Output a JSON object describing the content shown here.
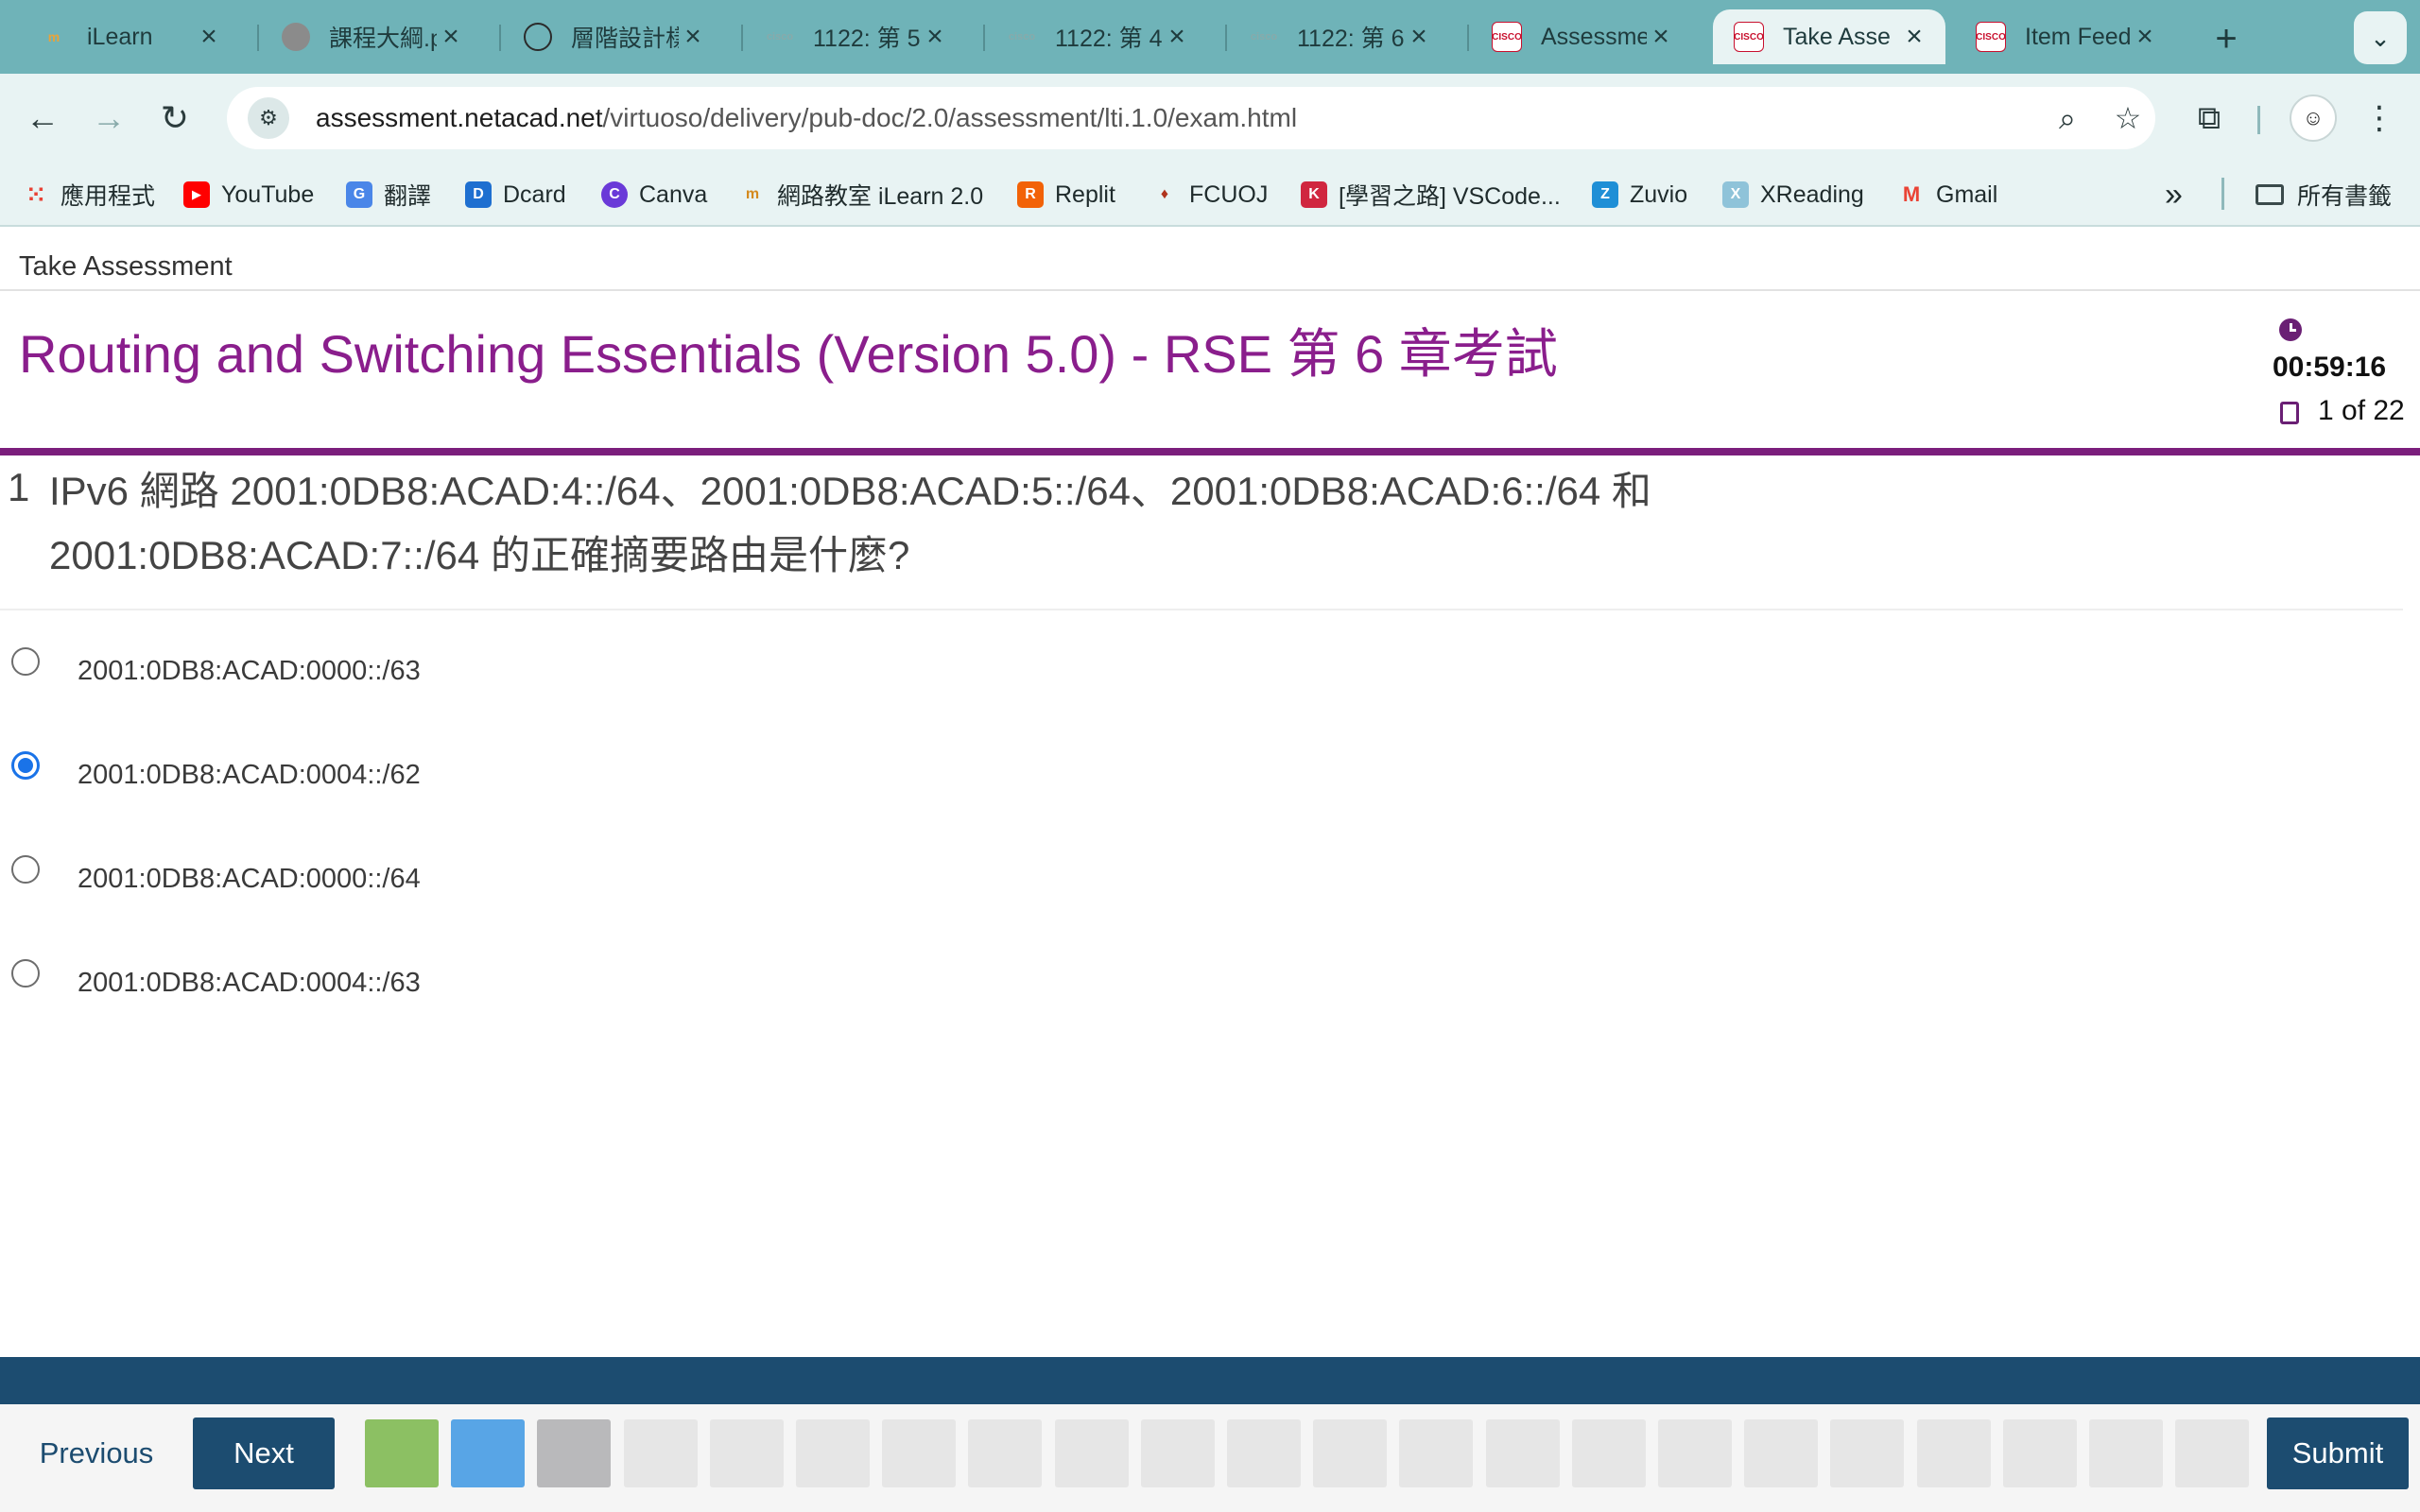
{
  "browser": {
    "tabs": [
      {
        "label": "iLearn",
        "favicon": "ilearn-icon",
        "color": "#e8a33a"
      },
      {
        "label": "課程大綱.p",
        "favicon": "seal-icon",
        "color": "#7a7a7a"
      },
      {
        "label": "層階設計樣",
        "favicon": "chatgpt-icon",
        "color": "#2b2b2b"
      },
      {
        "label": "1122: 第 5",
        "favicon": "cisco-icon",
        "color": "#9ab"
      },
      {
        "label": "1122: 第 4",
        "favicon": "cisco-icon",
        "color": "#9ab"
      },
      {
        "label": "1122: 第 6",
        "favicon": "cisco-icon",
        "color": "#9ab"
      },
      {
        "label": "Assessme",
        "favicon": "cisco-icon",
        "color": "#c8102e"
      },
      {
        "label": "Take Asse",
        "favicon": "cisco-icon",
        "color": "#c8102e",
        "active": true
      },
      {
        "label": "Item Feed",
        "favicon": "cisco-icon",
        "color": "#c8102e"
      }
    ],
    "url_host": "assessment.netacad.net",
    "url_path": "/virtuoso/delivery/pub-doc/2.0/assessment/lti.1.0/exam.html",
    "bookmarks": [
      {
        "label": "應用程式",
        "icon": "apps-grid-icon"
      },
      {
        "label": "YouTube",
        "icon": "youtube-icon"
      },
      {
        "label": "翻譯",
        "icon": "translate-icon"
      },
      {
        "label": "Dcard",
        "icon": "dcard-icon"
      },
      {
        "label": "Canva",
        "icon": "canva-icon"
      },
      {
        "label": "網路教室 iLearn 2.0",
        "icon": "ilearn-icon"
      },
      {
        "label": "Replit",
        "icon": "replit-icon"
      },
      {
        "label": "FCUOJ",
        "icon": "fcuoj-icon"
      },
      {
        "label": "[學習之路] VSCode...",
        "icon": "vscode-bookmark-icon"
      },
      {
        "label": "Zuvio",
        "icon": "zuvio-icon"
      },
      {
        "label": "XReading",
        "icon": "xreading-icon"
      },
      {
        "label": "Gmail",
        "icon": "gmail-icon"
      }
    ],
    "all_bookmarks": "所有書籤"
  },
  "page": {
    "breadcrumb": "Take Assessment",
    "title": "Routing and Switching Essentials (Version 5.0) - RSE 第 6 章考試",
    "timer": "00:59:16",
    "counter": "1 of 22",
    "accent": "#7b1e7c"
  },
  "question": {
    "number": "1",
    "text": "IPv6 網路 2001:0DB8:ACAD:4::/64、2001:0DB8:ACAD:5::/64、2001:0DB8:ACAD:6::/64 和 2001:0DB8:ACAD:7::/64 的正確摘要路由是什麼?",
    "options": [
      {
        "label": "2001:0DB8:ACAD:0000::/63",
        "selected": false
      },
      {
        "label": "2001:0DB8:ACAD:0004::/62",
        "selected": true
      },
      {
        "label": "2001:0DB8:ACAD:0000::/64",
        "selected": false
      },
      {
        "label": "2001:0DB8:ACAD:0004::/63",
        "selected": false
      }
    ]
  },
  "footer": {
    "previous_label": "Previous",
    "next_label": "Next",
    "submit_label": "Submit",
    "question_boxes": [
      {
        "state": "answered",
        "color": "#8cc063"
      },
      {
        "state": "current",
        "color": "#58a5e6"
      },
      {
        "state": "visited",
        "color": "#b9b9bb"
      },
      {
        "state": "unvisited",
        "color": "#e6e6e6"
      },
      {
        "state": "unvisited",
        "color": "#e6e6e6"
      },
      {
        "state": "unvisited",
        "color": "#e6e6e6"
      },
      {
        "state": "unvisited",
        "color": "#e6e6e6"
      },
      {
        "state": "unvisited",
        "color": "#e6e6e6"
      },
      {
        "state": "unvisited",
        "color": "#e6e6e6"
      },
      {
        "state": "unvisited",
        "color": "#e6e6e6"
      },
      {
        "state": "unvisited",
        "color": "#e6e6e6"
      },
      {
        "state": "unvisited",
        "color": "#e6e6e6"
      },
      {
        "state": "unvisited",
        "color": "#e6e6e6"
      },
      {
        "state": "unvisited",
        "color": "#e6e6e6"
      },
      {
        "state": "unvisited",
        "color": "#e6e6e6"
      },
      {
        "state": "unvisited",
        "color": "#e6e6e6"
      },
      {
        "state": "unvisited",
        "color": "#e6e6e6"
      },
      {
        "state": "unvisited",
        "color": "#e6e6e6"
      },
      {
        "state": "unvisited",
        "color": "#e6e6e6"
      },
      {
        "state": "unvisited",
        "color": "#e6e6e6"
      },
      {
        "state": "unvisited",
        "color": "#e6e6e6"
      },
      {
        "state": "unvisited",
        "color": "#e6e6e6"
      }
    ]
  }
}
